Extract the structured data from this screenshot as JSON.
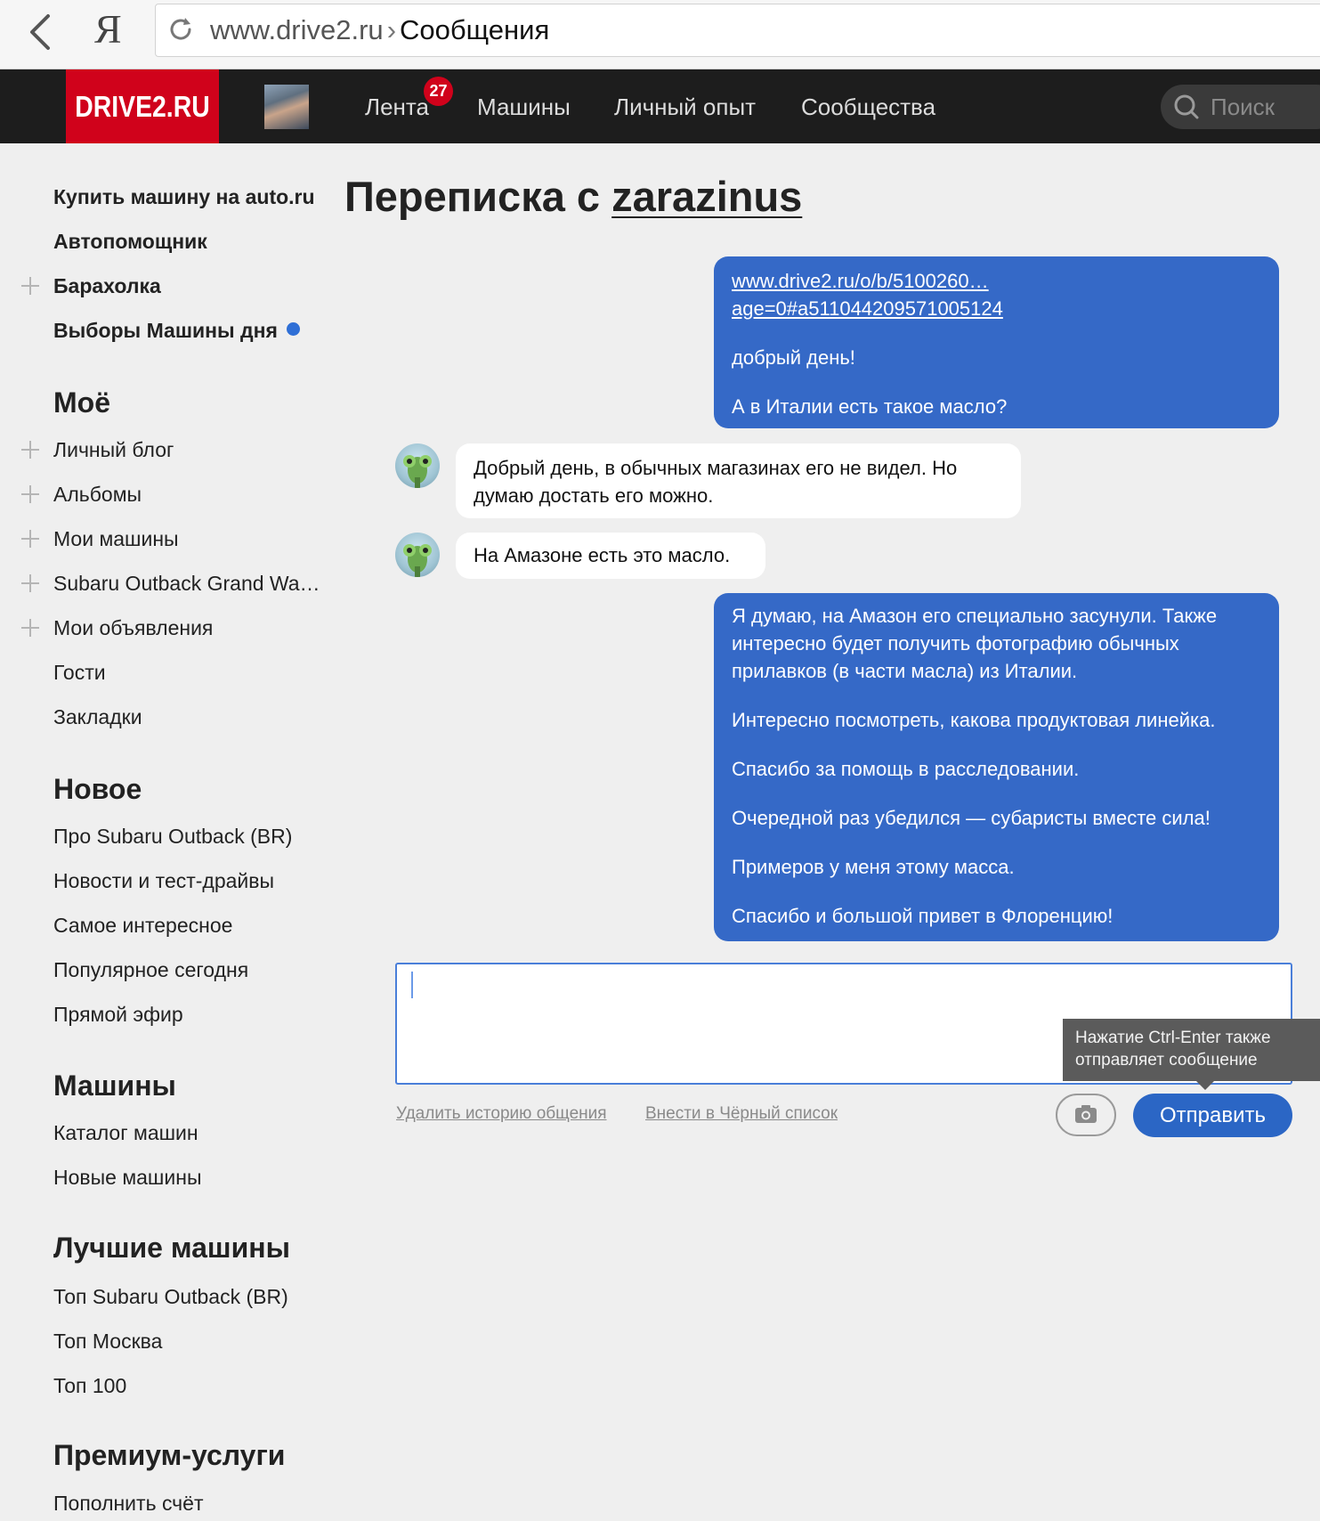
{
  "browser": {
    "ya_label": "Я",
    "url_domain": "www.drive2.ru",
    "url_separator": "›",
    "url_page": "Сообщения"
  },
  "header": {
    "logo": "DRIVE2.RU",
    "nav": {
      "feed": "Лента",
      "feed_badge": "27",
      "cars": "Машины",
      "experience": "Личный опыт",
      "communities": "Сообщества"
    },
    "search_placeholder": "Поиск"
  },
  "sidebar": {
    "top_links": [
      "Купить машину на auto.ru",
      "Автопомощник",
      "Барахолка",
      "Выборы Машины дня"
    ],
    "my": {
      "heading": "Моё",
      "items": [
        "Личный блог",
        "Альбомы",
        "Мои машины",
        "Subaru Outback Grand Wa…",
        "Мои объявления",
        "Гости",
        "Закладки"
      ]
    },
    "new": {
      "heading": "Новое",
      "items": [
        "Про Subaru Outback (BR)",
        "Новости и тест-драйвы",
        "Самое интересное",
        "Популярное сегодня",
        "Прямой эфир"
      ]
    },
    "cars": {
      "heading": "Машины",
      "items": [
        "Каталог машин",
        "Новые машины"
      ]
    },
    "best": {
      "heading": "Лучшие машины",
      "items": [
        "Топ Subaru Outback (BR)",
        "Топ Москва",
        "Топ 100"
      ]
    },
    "premium": {
      "heading": "Премиум-услуги",
      "items": [
        "Пополнить счёт"
      ]
    }
  },
  "main": {
    "title_prefix": "Переписка с",
    "title_user": "zarazinus",
    "messages": {
      "m1": {
        "link_line1": "www.drive2.ru/o/b/5100260…",
        "link_line2": "age=0#a511044209571005124",
        "p1": "добрый день!",
        "p2": "А в Италии есть такое масло?"
      },
      "m2": {
        "text": "Добрый день, в обычных магазинах его не видел. Но думаю достать его можно."
      },
      "m3": {
        "text": "На Амазоне есть это масло."
      },
      "m4": {
        "p1": "Я думаю, на Амазон его специально засунули. Также интересно будет получить фотографию обычных прилавков (в части масла) из Италии.",
        "p2": "Интересно посмотреть, какова продуктовая линейка.",
        "p3": "Спасибо за помощь в расследовании.",
        "p4": "Очередной раз убедился — субаристы вместе сила!",
        "p5": "Примеров у меня этому масса.",
        "p6": "Спасибо и большой привет в Флоренцию!"
      }
    },
    "composer_value": "",
    "delete_history": "Удалить историю общения",
    "blacklist": "Внести в Чёрный список",
    "send_label": "Отправить",
    "tooltip_line1": "Нажатие Ctrl-Enter также",
    "tooltip_line2": "отправляет сообщение"
  },
  "colors": {
    "brand_red": "#d0021b",
    "header_bg": "#1d1d1d",
    "outgoing_bubble": "#3569c7",
    "send_button": "#2b66c5",
    "page_bg": "#efefef"
  },
  "icons": [
    "back-arrow-icon",
    "reload-icon",
    "search-icon",
    "plus-icon",
    "camera-icon",
    "chameleon-avatar"
  ]
}
